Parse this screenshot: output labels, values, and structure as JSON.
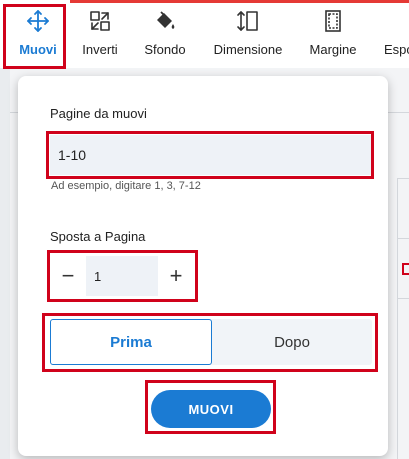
{
  "toolbar": {
    "items": [
      {
        "label": "Muovi",
        "icon": "move-arrows-icon",
        "active": true
      },
      {
        "label": "Inverti",
        "icon": "swap-arrows-icon"
      },
      {
        "label": "Sfondo",
        "icon": "paint-bucket-icon"
      },
      {
        "label": "Dimensione",
        "icon": "resize-height-icon"
      },
      {
        "label": "Margine",
        "icon": "margin-page-icon"
      },
      {
        "label": "Espo",
        "icon": "export-icon"
      }
    ]
  },
  "popup": {
    "pages_label": "Pagine da muovi",
    "pages_value": "1-10",
    "pages_hint": "Ad esempio, digitare 1, 3, 7-12",
    "target_label": "Sposta a Pagina",
    "target_value": "1",
    "decrement_symbol": "−",
    "increment_symbol": "+",
    "position_options": [
      "Prima",
      "Dopo"
    ],
    "selected_option": "Prima",
    "submit_label": "MUOVI"
  },
  "colors": {
    "accent": "#1b7bd3",
    "highlight": "#d0021b",
    "field_bg": "#eef2f7"
  }
}
